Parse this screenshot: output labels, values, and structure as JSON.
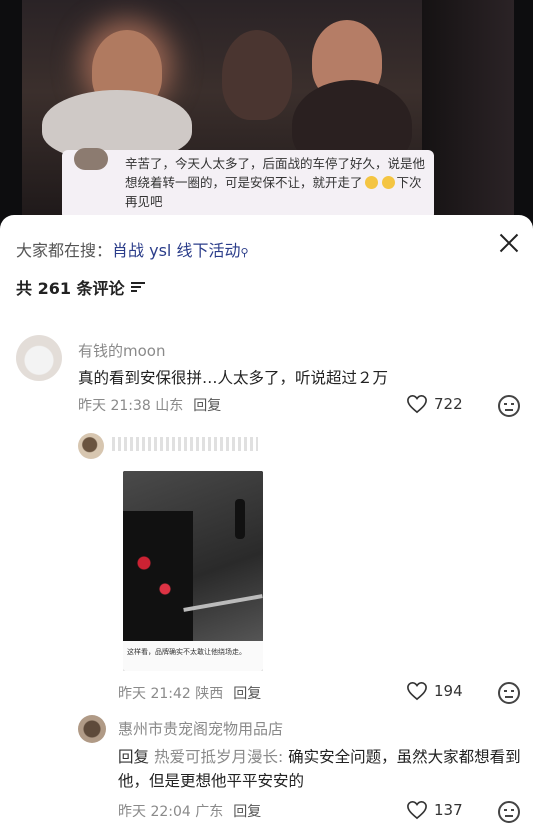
{
  "video": {
    "caption": "辛苦了，今天人太多了，后面战的车停了好久，说是他想绕着转一圈的，可是安保不让，就开走了",
    "caption_tail": "下次再见吧"
  },
  "sheet": {
    "search_prefix": "大家都在搜：",
    "search_keyword": "肖战 ysl 线下活动",
    "comment_count": "共 261 条评论"
  },
  "comments": [
    {
      "username": "有钱的moon",
      "text": "真的看到安保很拼…人太多了，听说超过２万",
      "meta": "昨天 21:38 山东",
      "reply_label": "回复",
      "likes": "722"
    },
    {
      "image_caption": "这样看，品牌确实不太敢让他绕场走。",
      "meta": "昨天 21:42 陕西",
      "reply_label": "回复",
      "likes": "194"
    },
    {
      "username": "惠州市贵宠阁宠物用品店",
      "reply_prefix": "回复",
      "reply_to": "热爱可抵岁月漫长:",
      "text": "确实安全问题，虽然大家都想看到他，但是更想他平平安安的",
      "meta": "昨天 22:04 广东",
      "reply_label": "回复",
      "likes": "137"
    }
  ]
}
